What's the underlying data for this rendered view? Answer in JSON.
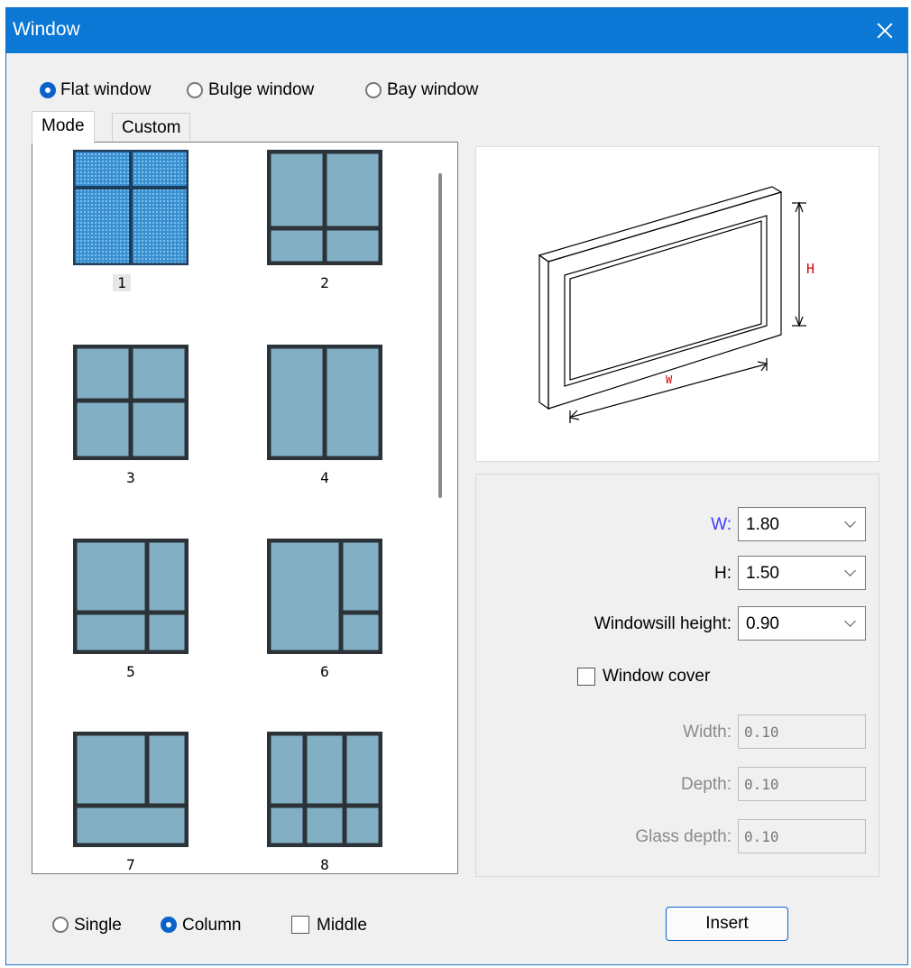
{
  "window": {
    "title": "Window"
  },
  "type_options": [
    {
      "label": "Flat window",
      "selected": true
    },
    {
      "label": "Bulge window",
      "selected": false
    },
    {
      "label": "Bay window",
      "selected": false
    }
  ],
  "tabs": [
    {
      "label": "Mode",
      "active": true
    },
    {
      "label": "Custom",
      "active": false
    }
  ],
  "thumbnails": [
    {
      "label": "1",
      "selected": true
    },
    {
      "label": "2"
    },
    {
      "label": "3"
    },
    {
      "label": "4"
    },
    {
      "label": "5"
    },
    {
      "label": "6"
    },
    {
      "label": "7"
    },
    {
      "label": "8"
    }
  ],
  "preview": {
    "h_label": "H",
    "w_label": "W"
  },
  "params": {
    "w_label": "W:",
    "w_value": "1.80",
    "h_label": "H:",
    "h_value": "1.50",
    "sill_label": "Windowsill height:",
    "sill_value": "0.90",
    "cover_label": "Window cover",
    "cover_checked": false,
    "width_label": "Width:",
    "width_value": "0.10",
    "depth_label": "Depth:",
    "depth_value": "0.10",
    "glass_depth_label": "Glass depth:",
    "glass_depth_value": "0.10"
  },
  "bottom": {
    "single_label": "Single",
    "column_label": "Column",
    "column_selected": true,
    "middle_label": "Middle",
    "middle_checked": false,
    "insert_label": "Insert"
  },
  "colors": {
    "accent": "#0a63c9",
    "titlebar": "#0a78d4",
    "pane": "#82afc4",
    "frame": "#2b3238",
    "w_label": "#3c3cff",
    "dim_red": "#e00000"
  }
}
